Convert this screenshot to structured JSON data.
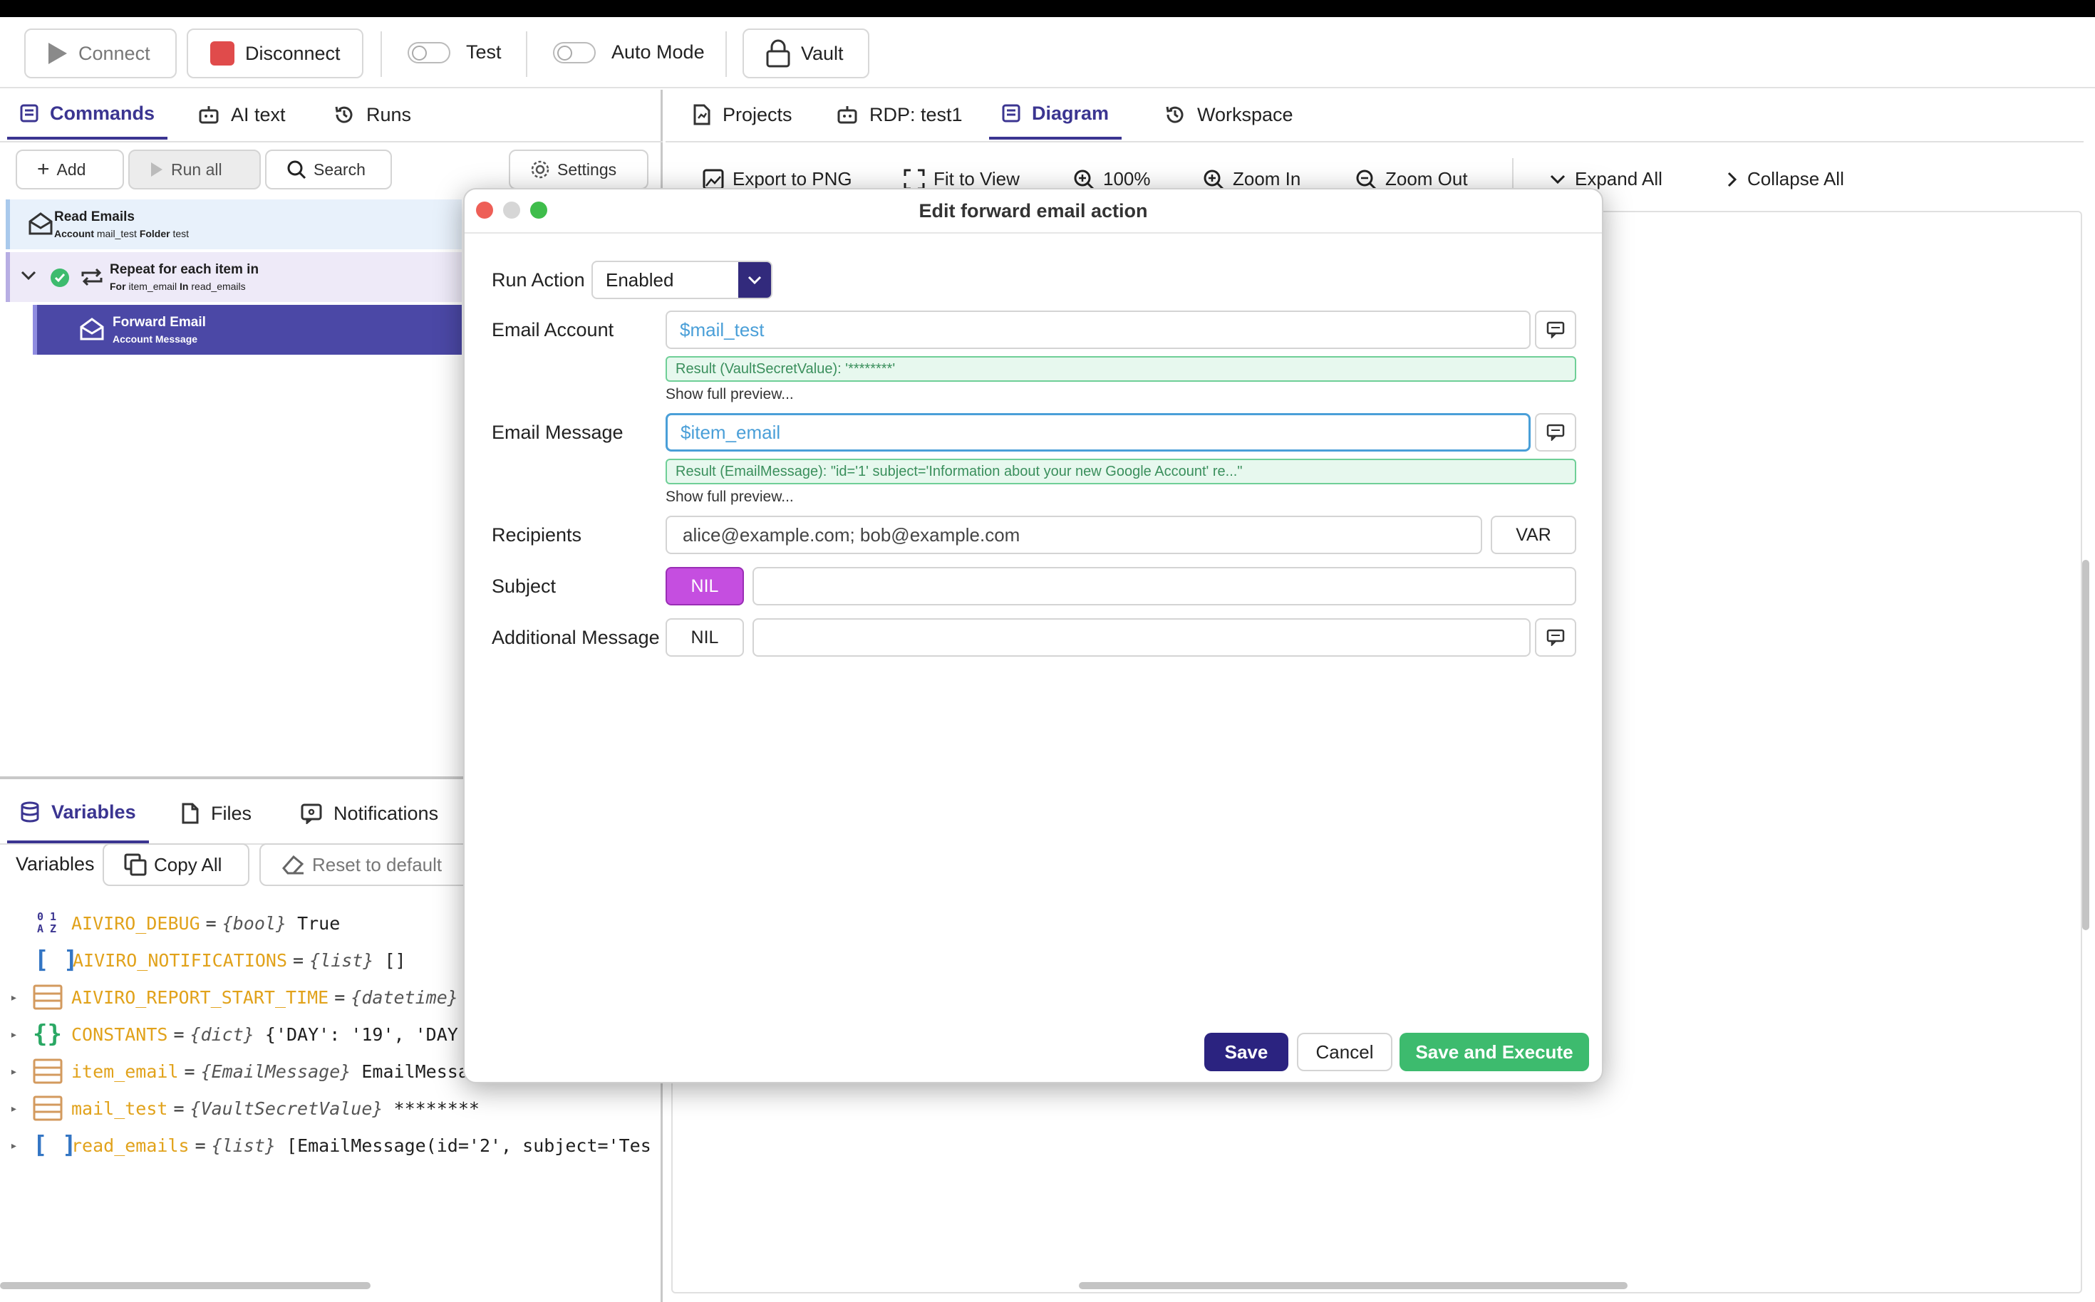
{
  "toolbar": {
    "connect_label": "Connect",
    "disconnect_label": "Disconnect",
    "test_label": "Test",
    "auto_mode_label": "Auto Mode",
    "vault_label": "Vault"
  },
  "left_tabs": [
    "Commands",
    "AI text",
    "Runs"
  ],
  "commands_toolbar": {
    "add_label": "Add",
    "run_all_label": "Run all",
    "search_label": "Search",
    "settings_label": "Settings"
  },
  "commands": [
    {
      "title": "Read Emails",
      "k1": "Account",
      "v1": "mail_test",
      "k2": "Folder",
      "v2": "test"
    },
    {
      "title": "Repeat for each item in",
      "k1": "For",
      "v1": "item_email",
      "k2": "In",
      "v2": "read_emails"
    },
    {
      "title": "Forward Email",
      "k1": "Account",
      "v1": "",
      "k2": "Message",
      "v2": ""
    }
  ],
  "bottom_tabs": [
    "Variables",
    "Files",
    "Notifications"
  ],
  "variables_toolbar": {
    "label": "Variables",
    "copy_all_label": "Copy All",
    "reset_label": "Reset to default"
  },
  "variables": [
    {
      "name": "AIVIRO_DEBUG",
      "type": "{bool}",
      "value": "True"
    },
    {
      "name": "AIVIRO_NOTIFICATIONS",
      "type": "{list}",
      "value": "[]"
    },
    {
      "name": "AIVIRO_REPORT_START_TIME",
      "type": "{datetime}",
      "value": ""
    },
    {
      "name": "CONSTANTS",
      "type": "{dict}",
      "value": "{'DAY': '19', 'DAY"
    },
    {
      "name": "item_email",
      "type": "{EmailMessage}",
      "value": "EmailMessa"
    },
    {
      "name": "mail_test",
      "type": "{VaultSecretValue}",
      "value": "********"
    },
    {
      "name": "read_emails",
      "type": "{list}",
      "value": "[EmailMessage(id='2', subject='Tes"
    }
  ],
  "right_tabs": [
    "Projects",
    "RDP: test1",
    "Diagram",
    "Workspace"
  ],
  "diagram_toolbar": {
    "export_label": "Export to PNG",
    "fit_label": "Fit to View",
    "zoom_level": "100%",
    "zoom_in_label": "Zoom In",
    "zoom_out_label": "Zoom Out",
    "expand_label": "Expand All",
    "collapse_label": "Collapse All"
  },
  "dialog": {
    "title": "Edit forward email action",
    "run_action_label": "Run Action",
    "run_action_value": "Enabled",
    "email_account_label": "Email Account",
    "email_account_value": "$mail_test",
    "email_account_result": "Result (VaultSecretValue): '********'",
    "email_message_label": "Email Message",
    "email_message_value": "$item_email",
    "email_message_result": "Result (EmailMessage): \"id='1' subject='Information about your new Google Account' re...\"",
    "show_preview_label": "Show full preview...",
    "recipients_label": "Recipients",
    "recipients_value": "alice@example.com; bob@example.com",
    "var_label": "VAR",
    "subject_label": "Subject",
    "subject_value": "",
    "additional_message_label": "Additional Message",
    "additional_message_value": "",
    "nil_label": "NIL",
    "save_label": "Save",
    "cancel_label": "Cancel",
    "save_execute_label": "Save and Execute"
  },
  "colors": {
    "accent": "#3b3591",
    "selected_command": "#4b48a6",
    "nil_active": "#c54ee0",
    "success": "#3dbb6e",
    "danger": "#e04b4b"
  }
}
